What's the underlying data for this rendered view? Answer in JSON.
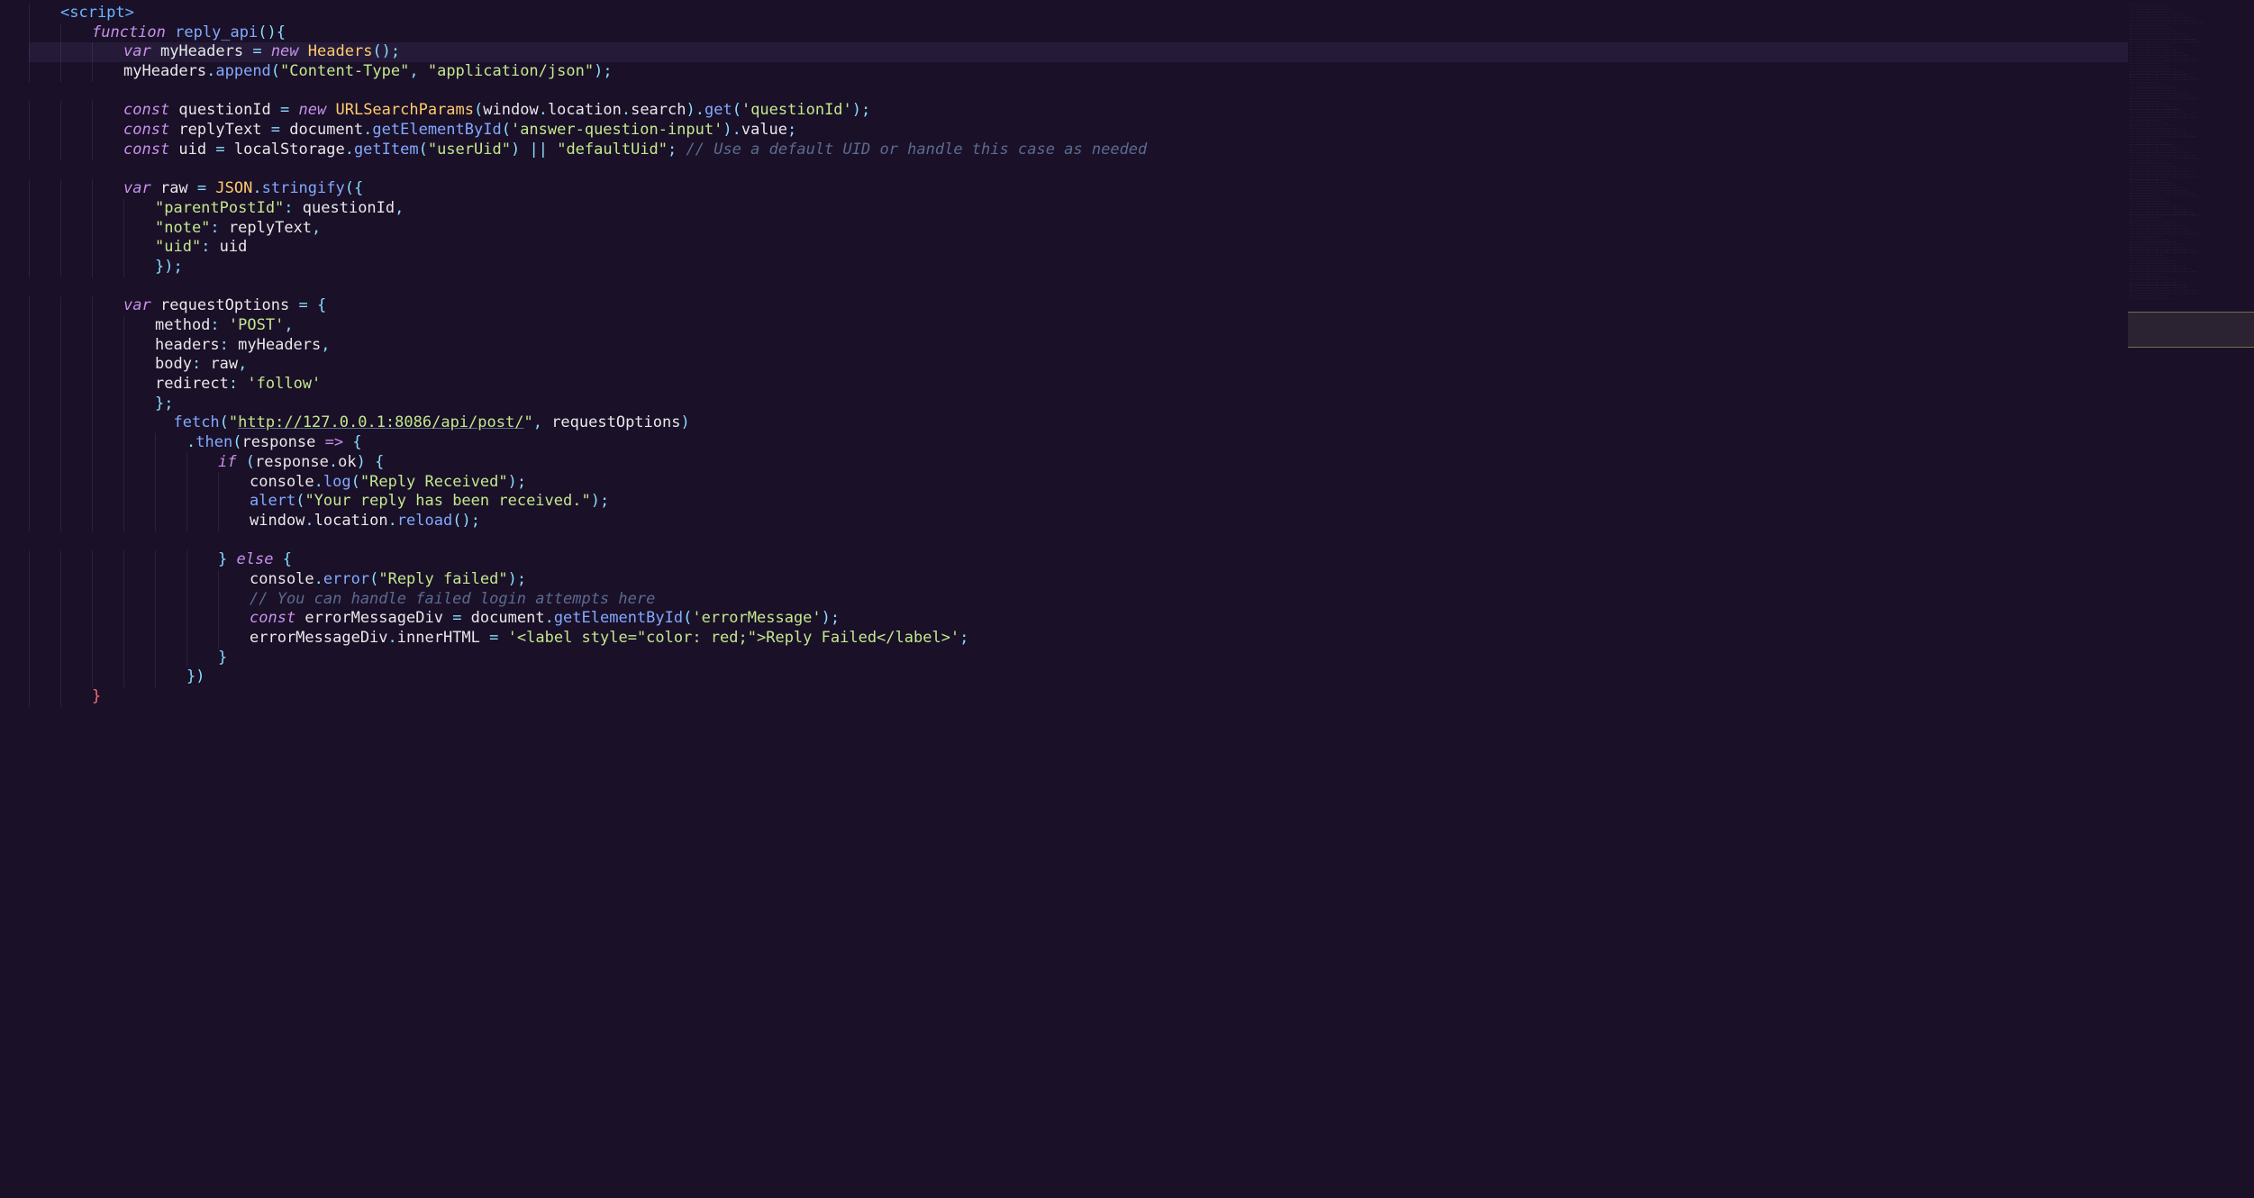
{
  "code": {
    "lines": [
      {
        "indent": 1,
        "tokens": [
          {
            "t": "<script>",
            "c": "tag"
          }
        ]
      },
      {
        "indent": 2,
        "tokens": [
          {
            "t": "function",
            "c": "keyword"
          },
          {
            "t": " "
          },
          {
            "t": "reply_api",
            "c": "func-name"
          },
          {
            "t": "()",
            "c": "punct"
          },
          {
            "t": "{",
            "c": "punct"
          }
        ]
      },
      {
        "indent": 3,
        "highlighted": true,
        "tokens": [
          {
            "t": "var",
            "c": "keyword-decl"
          },
          {
            "t": " myHeaders "
          },
          {
            "t": "=",
            "c": "op"
          },
          {
            "t": " "
          },
          {
            "t": "new",
            "c": "keyword"
          },
          {
            "t": " "
          },
          {
            "t": "Headers",
            "c": "class-name"
          },
          {
            "t": "();",
            "c": "punct"
          }
        ]
      },
      {
        "indent": 3,
        "tokens": [
          {
            "t": "myHeaders"
          },
          {
            "t": ".",
            "c": "punct"
          },
          {
            "t": "append",
            "c": "method"
          },
          {
            "t": "(",
            "c": "punct"
          },
          {
            "t": "\"Content-Type\"",
            "c": "string"
          },
          {
            "t": ",",
            "c": "punct"
          },
          {
            "t": " "
          },
          {
            "t": "\"application/json\"",
            "c": "string"
          },
          {
            "t": ");",
            "c": "punct"
          }
        ]
      },
      {
        "indent": 0,
        "tokens": []
      },
      {
        "indent": 3,
        "tokens": [
          {
            "t": "const",
            "c": "keyword-decl"
          },
          {
            "t": " questionId "
          },
          {
            "t": "=",
            "c": "op"
          },
          {
            "t": " "
          },
          {
            "t": "new",
            "c": "keyword"
          },
          {
            "t": " "
          },
          {
            "t": "URLSearchParams",
            "c": "class-name"
          },
          {
            "t": "(",
            "c": "punct"
          },
          {
            "t": "window"
          },
          {
            "t": ".",
            "c": "punct"
          },
          {
            "t": "location"
          },
          {
            "t": ".",
            "c": "punct"
          },
          {
            "t": "search"
          },
          {
            "t": ").",
            "c": "punct"
          },
          {
            "t": "get",
            "c": "method"
          },
          {
            "t": "(",
            "c": "punct"
          },
          {
            "t": "'questionId'",
            "c": "string"
          },
          {
            "t": ");",
            "c": "punct"
          }
        ]
      },
      {
        "indent": 3,
        "tokens": [
          {
            "t": "const",
            "c": "keyword-decl"
          },
          {
            "t": " replyText "
          },
          {
            "t": "=",
            "c": "op"
          },
          {
            "t": " document"
          },
          {
            "t": ".",
            "c": "punct"
          },
          {
            "t": "getElementById",
            "c": "method"
          },
          {
            "t": "(",
            "c": "punct"
          },
          {
            "t": "'answer-question-input'",
            "c": "string"
          },
          {
            "t": ").",
            "c": "punct"
          },
          {
            "t": "value"
          },
          {
            "t": ";",
            "c": "punct"
          }
        ]
      },
      {
        "indent": 3,
        "tokens": [
          {
            "t": "const",
            "c": "keyword-decl"
          },
          {
            "t": " uid "
          },
          {
            "t": "=",
            "c": "op"
          },
          {
            "t": " localStorage"
          },
          {
            "t": ".",
            "c": "punct"
          },
          {
            "t": "getItem",
            "c": "method"
          },
          {
            "t": "(",
            "c": "punct"
          },
          {
            "t": "\"userUid\"",
            "c": "string"
          },
          {
            "t": ")",
            "c": "punct"
          },
          {
            "t": " "
          },
          {
            "t": "||",
            "c": "op"
          },
          {
            "t": " "
          },
          {
            "t": "\"defaultUid\"",
            "c": "string"
          },
          {
            "t": ";",
            "c": "punct"
          },
          {
            "t": " "
          },
          {
            "t": "// Use a default UID or handle this case as needed",
            "c": "comment"
          }
        ]
      },
      {
        "indent": 0,
        "tokens": []
      },
      {
        "indent": 3,
        "tokens": [
          {
            "t": "var",
            "c": "keyword-decl"
          },
          {
            "t": " raw "
          },
          {
            "t": "=",
            "c": "op"
          },
          {
            "t": " "
          },
          {
            "t": "JSON",
            "c": "builtin"
          },
          {
            "t": ".",
            "c": "punct"
          },
          {
            "t": "stringify",
            "c": "method"
          },
          {
            "t": "({",
            "c": "punct"
          }
        ]
      },
      {
        "indent": 4,
        "tokens": [
          {
            "t": "\"parentPostId\"",
            "c": "string"
          },
          {
            "t": ":",
            "c": "punct"
          },
          {
            "t": " questionId"
          },
          {
            "t": ",",
            "c": "punct"
          }
        ]
      },
      {
        "indent": 4,
        "tokens": [
          {
            "t": "\"note\"",
            "c": "string"
          },
          {
            "t": ":",
            "c": "punct"
          },
          {
            "t": " replyText"
          },
          {
            "t": ",",
            "c": "punct"
          }
        ]
      },
      {
        "indent": 4,
        "tokens": [
          {
            "t": "\"uid\"",
            "c": "string"
          },
          {
            "t": ":",
            "c": "punct"
          },
          {
            "t": " uid"
          }
        ]
      },
      {
        "indent": 4,
        "tokens": [
          {
            "t": "});",
            "c": "punct"
          }
        ]
      },
      {
        "indent": 0,
        "tokens": []
      },
      {
        "indent": 3,
        "tokens": [
          {
            "t": "var",
            "c": "keyword-decl"
          },
          {
            "t": " requestOptions "
          },
          {
            "t": "=",
            "c": "op"
          },
          {
            "t": " "
          },
          {
            "t": "{",
            "c": "punct"
          }
        ]
      },
      {
        "indent": 4,
        "tokens": [
          {
            "t": "method"
          },
          {
            "t": ":",
            "c": "punct"
          },
          {
            "t": " "
          },
          {
            "t": "'POST'",
            "c": "string"
          },
          {
            "t": ",",
            "c": "punct"
          }
        ]
      },
      {
        "indent": 4,
        "tokens": [
          {
            "t": "headers"
          },
          {
            "t": ":",
            "c": "punct"
          },
          {
            "t": " myHeaders"
          },
          {
            "t": ",",
            "c": "punct"
          }
        ]
      },
      {
        "indent": 4,
        "tokens": [
          {
            "t": "body"
          },
          {
            "t": ":",
            "c": "punct"
          },
          {
            "t": " raw"
          },
          {
            "t": ",",
            "c": "punct"
          }
        ]
      },
      {
        "indent": 4,
        "tokens": [
          {
            "t": "redirect"
          },
          {
            "t": ":",
            "c": "punct"
          },
          {
            "t": " "
          },
          {
            "t": "'follow'",
            "c": "string"
          }
        ]
      },
      {
        "indent": 4,
        "tokens": [
          {
            "t": "};",
            "c": "punct"
          }
        ]
      },
      {
        "indent": 4,
        "extra": "  ",
        "tokens": [
          {
            "t": "fetch",
            "c": "method"
          },
          {
            "t": "(",
            "c": "punct"
          },
          {
            "t": "\"",
            "c": "string"
          },
          {
            "t": "http://127.0.0.1:8086/api/post/",
            "c": "string url-underline"
          },
          {
            "t": "\"",
            "c": "string"
          },
          {
            "t": ",",
            "c": "punct"
          },
          {
            "t": " requestOptions"
          },
          {
            "t": ")",
            "c": "punct"
          }
        ]
      },
      {
        "indent": 5,
        "tokens": [
          {
            "t": ".",
            "c": "punct"
          },
          {
            "t": "then",
            "c": "method"
          },
          {
            "t": "(",
            "c": "punct"
          },
          {
            "t": "response",
            "c": "var-name"
          },
          {
            "t": " "
          },
          {
            "t": "=>",
            "c": "arrow"
          },
          {
            "t": " "
          },
          {
            "t": "{",
            "c": "punct"
          }
        ]
      },
      {
        "indent": 6,
        "tokens": [
          {
            "t": "if",
            "c": "keyword"
          },
          {
            "t": " (",
            "c": "punct"
          },
          {
            "t": "response"
          },
          {
            "t": ".",
            "c": "punct"
          },
          {
            "t": "ok"
          },
          {
            "t": ")",
            "c": "punct"
          },
          {
            "t": " "
          },
          {
            "t": "{",
            "c": "punct"
          }
        ]
      },
      {
        "indent": 7,
        "tokens": [
          {
            "t": "console"
          },
          {
            "t": ".",
            "c": "punct"
          },
          {
            "t": "log",
            "c": "method"
          },
          {
            "t": "(",
            "c": "punct"
          },
          {
            "t": "\"Reply Received\"",
            "c": "string"
          },
          {
            "t": ");",
            "c": "punct"
          }
        ]
      },
      {
        "indent": 7,
        "tokens": [
          {
            "t": "alert",
            "c": "method"
          },
          {
            "t": "(",
            "c": "punct"
          },
          {
            "t": "\"Your reply has been received.\"",
            "c": "string"
          },
          {
            "t": ");",
            "c": "punct"
          }
        ]
      },
      {
        "indent": 7,
        "tokens": [
          {
            "t": "window"
          },
          {
            "t": ".",
            "c": "punct"
          },
          {
            "t": "location"
          },
          {
            "t": ".",
            "c": "punct"
          },
          {
            "t": "reload",
            "c": "method"
          },
          {
            "t": "();",
            "c": "punct"
          }
        ]
      },
      {
        "indent": 0,
        "tokens": []
      },
      {
        "indent": 6,
        "tokens": [
          {
            "t": "}",
            "c": "punct"
          },
          {
            "t": " "
          },
          {
            "t": "else",
            "c": "keyword"
          },
          {
            "t": " "
          },
          {
            "t": "{",
            "c": "punct"
          }
        ]
      },
      {
        "indent": 7,
        "tokens": [
          {
            "t": "console"
          },
          {
            "t": ".",
            "c": "punct"
          },
          {
            "t": "error",
            "c": "method"
          },
          {
            "t": "(",
            "c": "punct"
          },
          {
            "t": "\"Reply failed\"",
            "c": "string"
          },
          {
            "t": ");",
            "c": "punct"
          }
        ]
      },
      {
        "indent": 7,
        "tokens": [
          {
            "t": "// You can handle failed login attempts here",
            "c": "comment"
          }
        ]
      },
      {
        "indent": 7,
        "tokens": [
          {
            "t": "const",
            "c": "keyword-decl"
          },
          {
            "t": " errorMessageDiv "
          },
          {
            "t": "=",
            "c": "op"
          },
          {
            "t": " document"
          },
          {
            "t": ".",
            "c": "punct"
          },
          {
            "t": "getElementById",
            "c": "method"
          },
          {
            "t": "(",
            "c": "punct"
          },
          {
            "t": "'errorMessage'",
            "c": "string"
          },
          {
            "t": ");",
            "c": "punct"
          }
        ]
      },
      {
        "indent": 7,
        "tokens": [
          {
            "t": "errorMessageDiv"
          },
          {
            "t": ".",
            "c": "punct"
          },
          {
            "t": "innerHTML"
          },
          {
            "t": " "
          },
          {
            "t": "=",
            "c": "op"
          },
          {
            "t": " "
          },
          {
            "t": "'<label style=\"color: red;\">Reply Failed</label>'",
            "c": "string"
          },
          {
            "t": ";",
            "c": "punct"
          }
        ]
      },
      {
        "indent": 6,
        "tokens": [
          {
            "t": "}",
            "c": "punct"
          }
        ]
      },
      {
        "indent": 5,
        "tokens": [
          {
            "t": "})",
            "c": "punct"
          }
        ]
      },
      {
        "indent": 2,
        "tokens": [
          {
            "t": "}",
            "c": "brace-pink"
          }
        ]
      }
    ]
  },
  "minimap": {
    "viewport": {
      "top_pct": 26,
      "height_pct": 3
    }
  }
}
